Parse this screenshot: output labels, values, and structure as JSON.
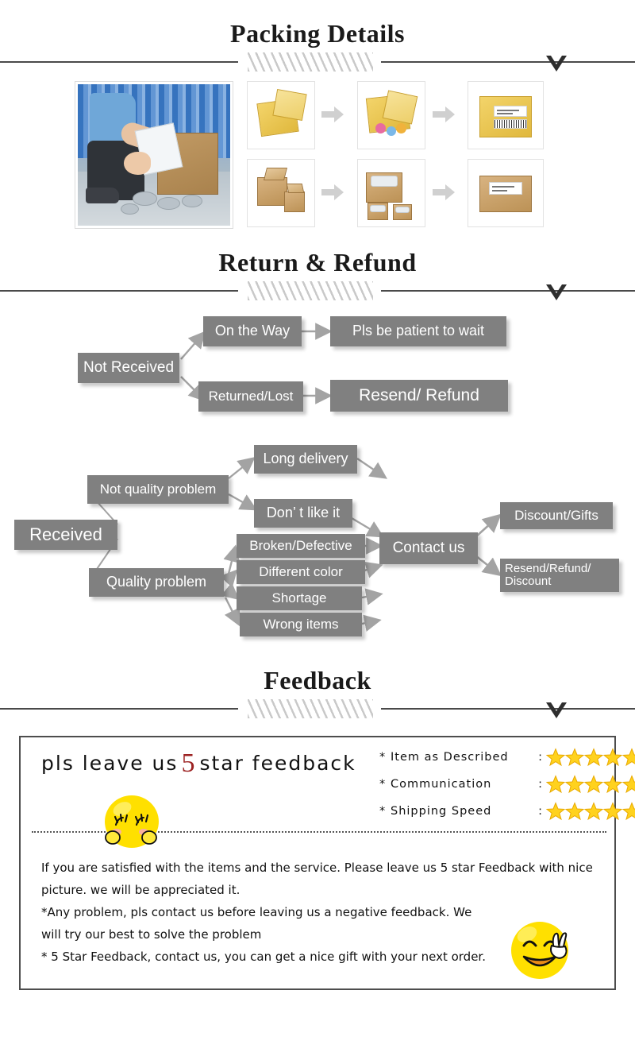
{
  "sections": [
    {
      "title": "Packing Details"
    },
    {
      "title": "Return & Refund"
    },
    {
      "title": "Feedback"
    }
  ],
  "packing": {
    "title": "Packing Details",
    "main_photo_alt": "worker-packing-parcel-photo",
    "rows": [
      {
        "steps": [
          "yellow-bubble-mailer",
          "mailer-with-goods",
          "sealed-labeled-mailer"
        ]
      },
      {
        "steps": [
          "open-carton-boxes",
          "carton-with-packed-goods",
          "sealed-labeled-carton"
        ]
      }
    ]
  },
  "return_refund": {
    "title": "Return & Refund",
    "not_received": {
      "root": "Not Received",
      "branches": [
        {
          "label": "On the Way",
          "result": "Pls be patient to wait"
        },
        {
          "label": "Returned/Lost",
          "result": "Resend/ Refund"
        }
      ]
    },
    "received": {
      "root": "Received",
      "not_quality": {
        "label": "Not quality problem",
        "reasons": [
          "Long delivery",
          "Don’ t like it"
        ]
      },
      "quality": {
        "label": "Quality problem",
        "reasons": [
          "Broken/Defective",
          "Different color",
          "Shortage",
          "Wrong items"
        ]
      },
      "contact": "Contact us",
      "outcomes": [
        "Discount/Gifts",
        "Resend/Refund/\nDiscount"
      ]
    }
  },
  "feedback": {
    "title": "Feedback",
    "headline_before": "pls leave us",
    "headline_number": "5",
    "headline_after": "star feedback",
    "ratings": [
      {
        "asterisk": "*",
        "label": "Item as Described",
        "colon": ":",
        "stars": 5
      },
      {
        "asterisk": "*",
        "label": "Communication",
        "colon": ":",
        "stars": 5
      },
      {
        "asterisk": "*",
        "label": "Shipping Speed",
        "colon": ":",
        "stars": 5
      }
    ],
    "body_lines": [
      "If you are satisfied with the items and the service. Please leave us 5 star Feedback with nice",
      "picture. we will be appreciated it.",
      "*Any problem, pls contact us before leaving us a negative feedback. We",
      "will try our best to solve  the problem",
      "* 5 Star Feedback, contact us, you can get a nice gift with your next order."
    ],
    "emoji_left": "blushing-closed-eyes-smiley",
    "emoji_right": "smiling-peace-sign-smiley",
    "star_color": "#ffd21e",
    "star_stroke": "#e8a900",
    "five_color": "#9c2222"
  },
  "colors": {
    "flow_box": "#808080",
    "flow_text": "#ffffff",
    "divider_rule": "#4a4a4a",
    "hatch": "#c9c9c9",
    "panel_border": "#4d4d4d"
  }
}
